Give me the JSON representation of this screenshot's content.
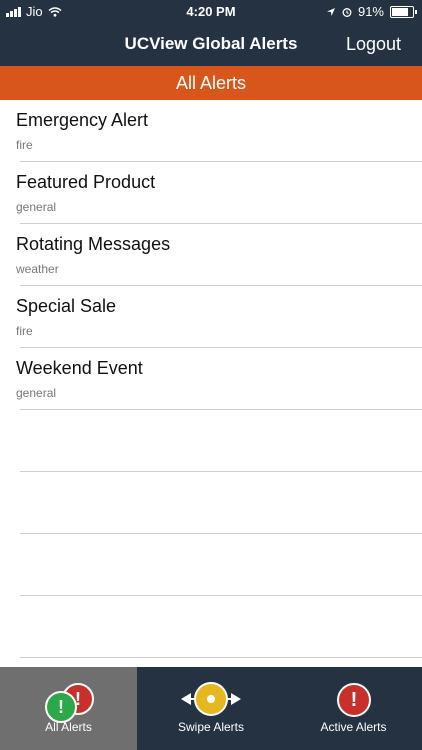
{
  "status": {
    "carrier": "Jio",
    "time": "4:20 PM",
    "battery": "91%",
    "battery_level": 0.91
  },
  "header": {
    "title": "UCView Global Alerts",
    "logout_label": "Logout"
  },
  "subheader": {
    "title": "All Alerts"
  },
  "alerts": [
    {
      "name": "Emergency Alert",
      "category": "fire"
    },
    {
      "name": "Featured Product",
      "category": "general"
    },
    {
      "name": "Rotating Messages",
      "category": "weather"
    },
    {
      "name": "Special Sale",
      "category": "fire"
    },
    {
      "name": "Weekend Event",
      "category": "general"
    }
  ],
  "tabs": [
    {
      "label": "All Alerts",
      "icon": "all-alerts-icon",
      "selected": true
    },
    {
      "label": "Swipe Alerts",
      "icon": "swipe-icon",
      "selected": false
    },
    {
      "label": "Active Alerts",
      "icon": "active-alert-icon",
      "selected": false
    }
  ],
  "colors": {
    "header": "#243242",
    "accent": "#D8561C",
    "green": "#2BA84A",
    "red": "#C8312B",
    "yellow": "#E5B820",
    "tab_selected": "#6f6f6f"
  }
}
